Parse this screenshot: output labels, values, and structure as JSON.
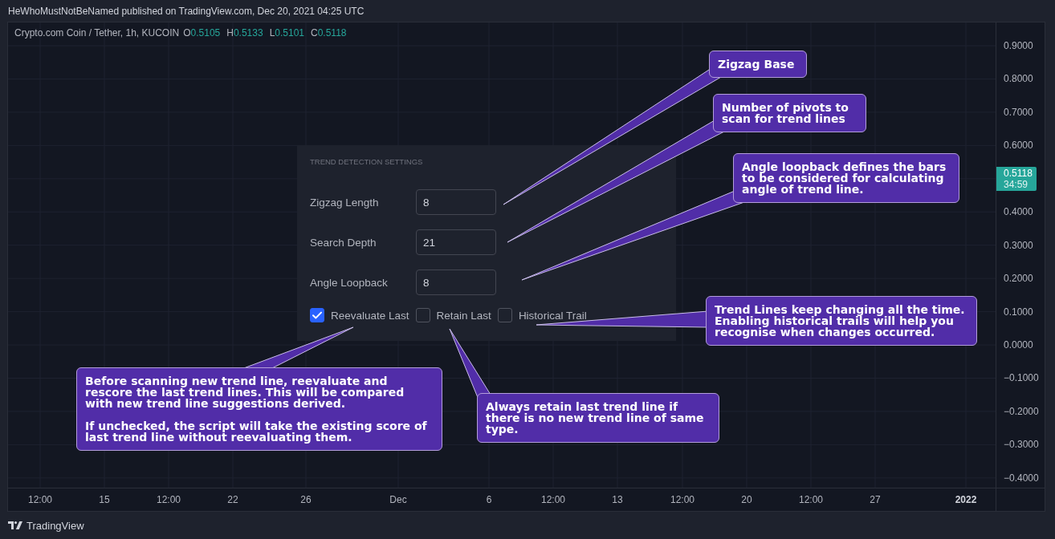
{
  "header": {
    "text": "HeWhoMustNotBeNamed published on TradingView.com, Dec 20, 2021 04:25 UTC"
  },
  "legend": {
    "symbol": "Crypto.com Coin / Tether, 1h, KUCOIN",
    "ohlc": [
      {
        "label": "O",
        "value": "0.5105"
      },
      {
        "label": "H",
        "value": "0.5133"
      },
      {
        "label": "L",
        "value": "0.5101"
      },
      {
        "label": "C",
        "value": "0.5118"
      }
    ]
  },
  "settings_panel": {
    "title": "TREND DETECTION SETTINGS",
    "fields": [
      {
        "label": "Zigzag Length",
        "value": "8"
      },
      {
        "label": "Search Depth",
        "value": "21"
      },
      {
        "label": "Angle Loopback",
        "value": "8"
      }
    ],
    "checkboxes": [
      {
        "label": "Reevaluate Last",
        "checked": true
      },
      {
        "label": "Retain Last",
        "checked": false
      },
      {
        "label": "Historical Trail",
        "checked": false
      }
    ]
  },
  "callouts": [
    {
      "paragraphs": [
        "Zigzag Base"
      ]
    },
    {
      "paragraphs": [
        "Number of pivots to scan for trend lines"
      ]
    },
    {
      "paragraphs": [
        "Angle loopback defines the bars to be considered for calculating angle of trend line."
      ]
    },
    {
      "paragraphs": [
        "Trend Lines keep changing all the time. Enabling historical trails will help you recognise when changes occurred."
      ]
    },
    {
      "paragraphs": [
        "Before scanning new trend line, reevaluate and rescore the last trend lines. This will be compared with new trend line suggestions derived.",
        "If unchecked, the script will take the existing score of last trend line without reevaluating them."
      ]
    },
    {
      "paragraphs": [
        "Always retain last trend line if there is no new trend line of same type."
      ]
    }
  ],
  "price_axis": {
    "items": [
      {
        "kind": "tick",
        "text": "0.9000"
      },
      {
        "kind": "tick",
        "text": "0.8000"
      },
      {
        "kind": "tick",
        "text": "0.7000"
      },
      {
        "kind": "tick",
        "text": "0.6000"
      },
      {
        "kind": "last_price",
        "value": "0.5118",
        "countdown": "34:59"
      },
      {
        "kind": "tick",
        "text": "0.4000"
      },
      {
        "kind": "tick",
        "text": "0.3000"
      },
      {
        "kind": "tick",
        "text": "0.2000"
      },
      {
        "kind": "tick",
        "text": "0.1000"
      },
      {
        "kind": "tick",
        "text": "0.0000"
      },
      {
        "kind": "tick",
        "text": "−0.1000"
      },
      {
        "kind": "tick",
        "text": "−0.2000"
      },
      {
        "kind": "tick",
        "text": "−0.3000"
      },
      {
        "kind": "tick",
        "text": "−0.4000"
      }
    ]
  },
  "time_axis": {
    "labels": [
      {
        "text": "12:00",
        "bold": false
      },
      {
        "text": "15",
        "bold": false
      },
      {
        "text": "12:00",
        "bold": false
      },
      {
        "text": "22",
        "bold": false
      },
      {
        "text": "26",
        "bold": false
      },
      {
        "text": "Dec",
        "bold": false
      },
      {
        "text": "6",
        "bold": false
      },
      {
        "text": "12:00",
        "bold": false
      },
      {
        "text": "13",
        "bold": false
      },
      {
        "text": "12:00",
        "bold": false
      },
      {
        "text": "20",
        "bold": false
      },
      {
        "text": "12:00",
        "bold": false
      },
      {
        "text": "27",
        "bold": false
      },
      {
        "text": "2022",
        "bold": true
      }
    ]
  },
  "footer": {
    "brand": "TradingView"
  }
}
